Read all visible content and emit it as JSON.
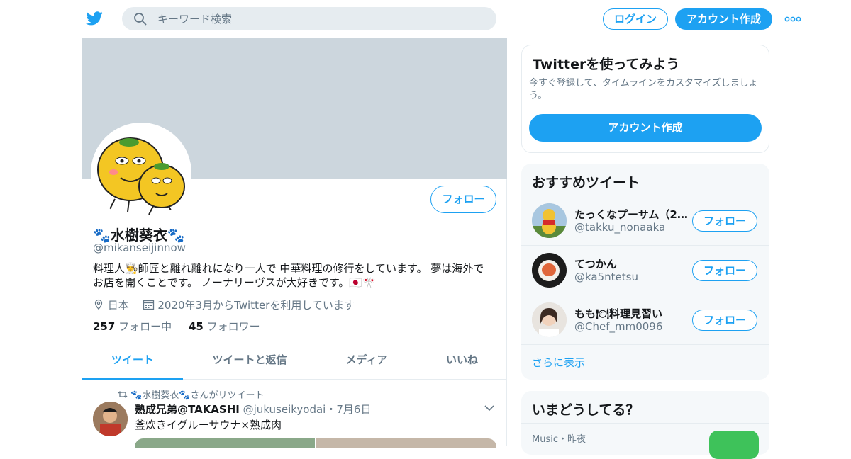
{
  "header": {
    "logo_icon": "twitter-bird-icon",
    "search_placeholder": "キーワード検索",
    "login_label": "ログイン",
    "signup_label": "アカウント作成",
    "more_icon": "more-dots-icon"
  },
  "profile": {
    "display_name": "🐾水樹葵衣🐾",
    "handle": "@mikanseijinnow",
    "follow_label": "フォロー",
    "bio": "料理人👨‍🍳師匠と離れ離れになり一人で 中華料理の修行をしています。 夢は海外でお店を開くことです。 ノーナリーヴスが大好きです。🇯🇵🎌",
    "location": "日本",
    "joined": "2020年3月からTwitterを利用しています",
    "following_count": "257",
    "following_label": "フォロー中",
    "followers_count": "45",
    "followers_label": "フォロワー"
  },
  "tabs": [
    "ツイート",
    "ツイートと返信",
    "メディア",
    "いいね"
  ],
  "tweet": {
    "retweet_line": "🐾水樹葵衣🐾さんがリツイート",
    "author_name": "熟成兄弟@TAKASHI",
    "author_handle": "@jukuseikyodai",
    "date": "・7月6日",
    "text": "釜炊きイグルーサウナ×熟成肉"
  },
  "signup_card": {
    "title": "Twitterを使ってみよう",
    "description": "今すぐ登録して、タイムラインをカスタマイズしましょう。",
    "button": "アカウント作成"
  },
  "recommended": {
    "title": "おすすめツイート",
    "users": [
      {
        "name": "たっくなプーサム（2…",
        "handle": "@takku_nonaaka",
        "follow": "フォロー"
      },
      {
        "name": "てつかん",
        "handle": "@ka5ntetsu",
        "follow": "フォロー"
      },
      {
        "name": "もも🍽料理見習い",
        "handle": "@Chef_mm0096",
        "follow": "フォロー"
      }
    ],
    "more_link": "さらに表示"
  },
  "trends": {
    "title": "いまどうしてる？",
    "meta": "Music・昨夜"
  },
  "colors": {
    "accent": "#1da1f2",
    "banner": "#ccd6dd",
    "muted": "#657786"
  }
}
